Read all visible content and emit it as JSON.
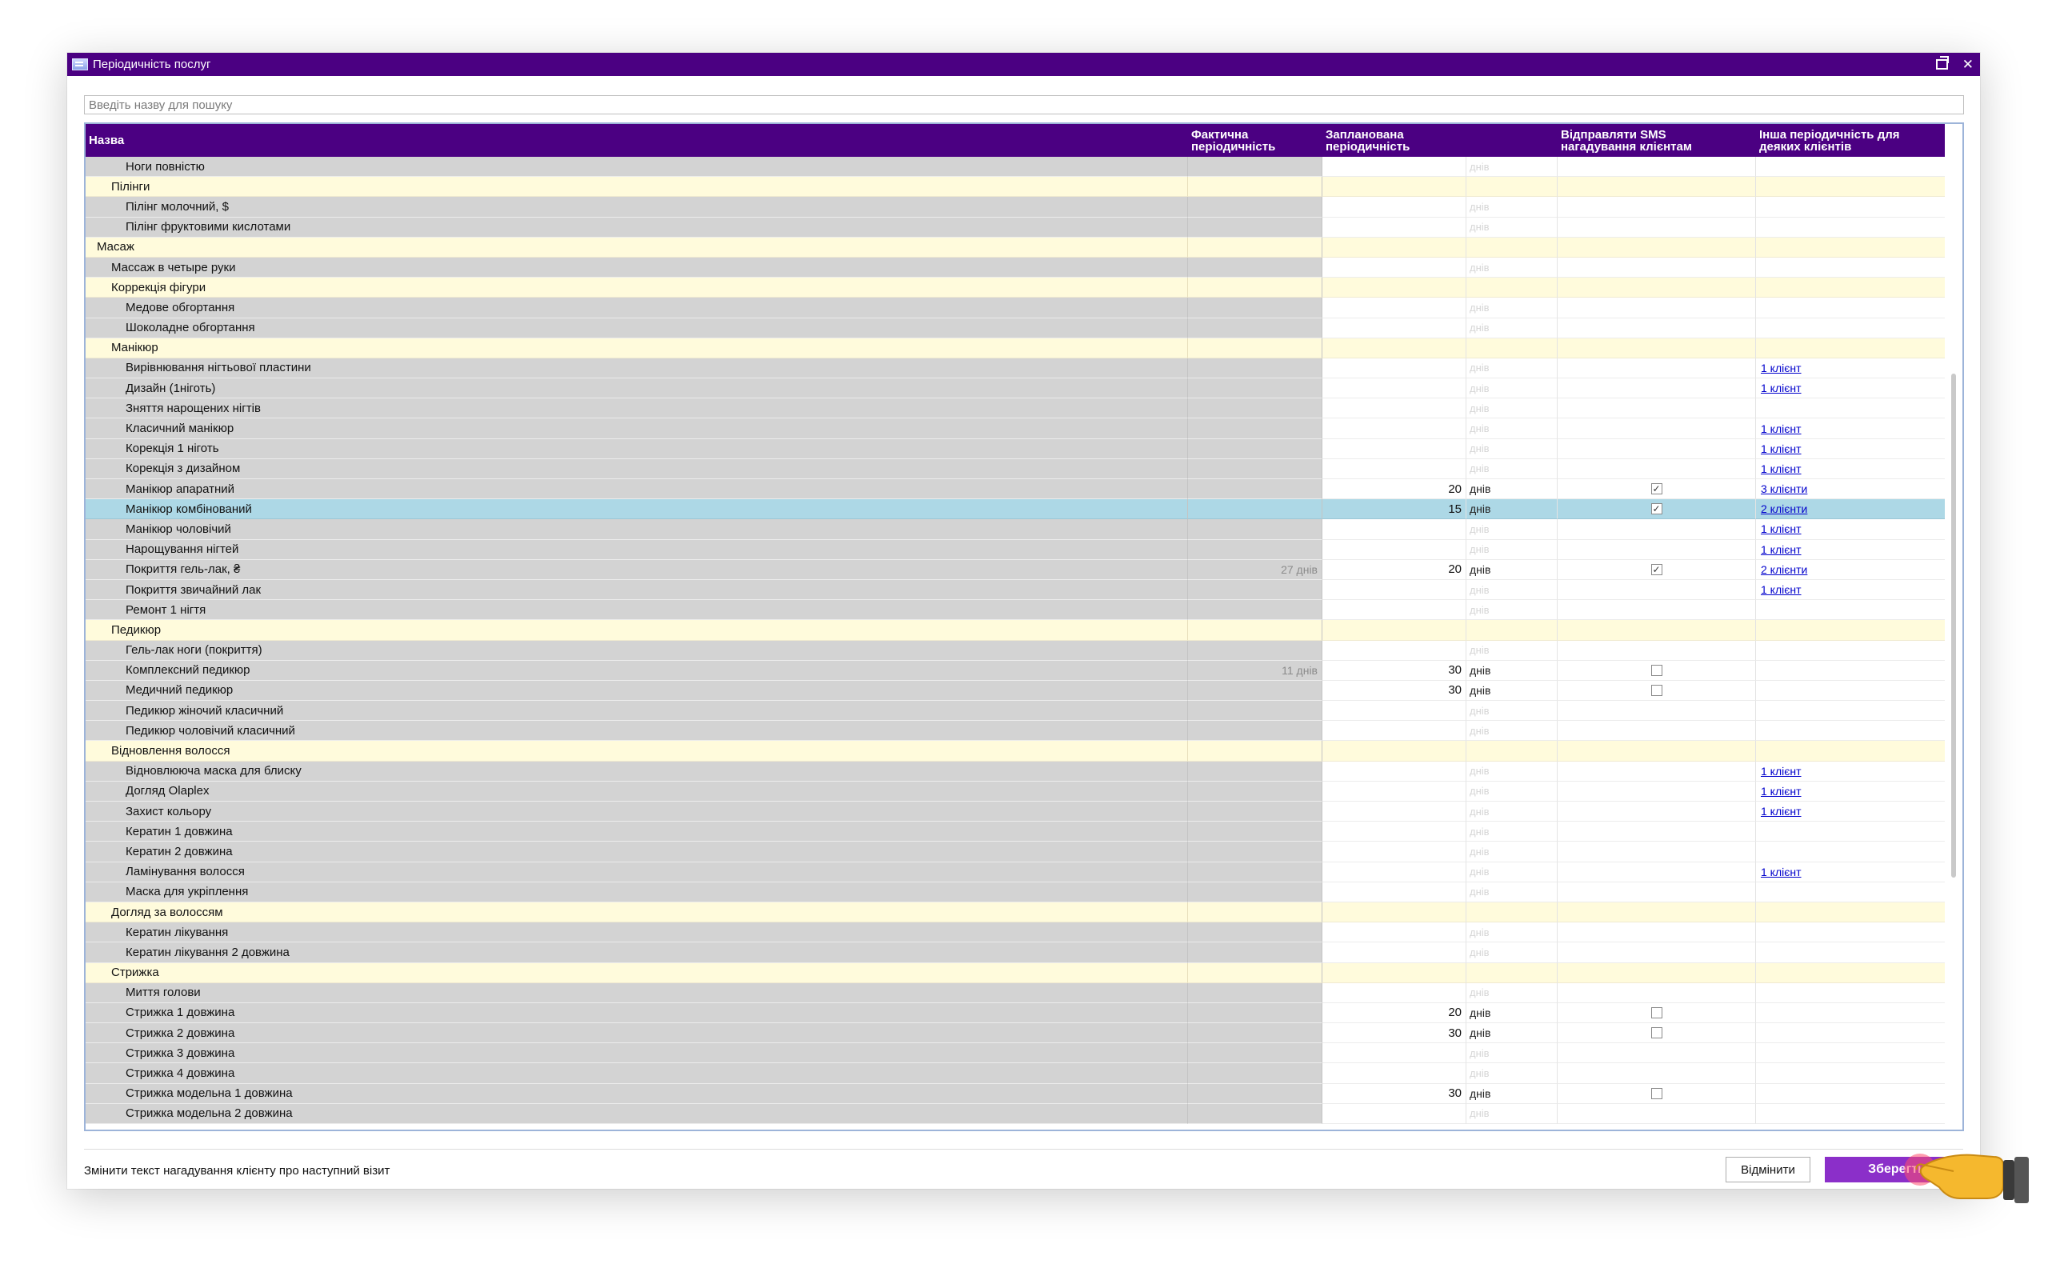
{
  "window": {
    "title": "Періодичність послуг"
  },
  "search": {
    "placeholder": "Введіть назву для пошуку"
  },
  "columns": {
    "name": "Назва",
    "fact": "Фактична періодичність",
    "plan": "Запланована періодичність",
    "sms": "Відправляти SMS нагадування клієнтам",
    "other": "Інша періодичність для деяких клієнтів"
  },
  "unit_label": "днів",
  "rows": [
    {
      "level": 3,
      "name": "Ноги повністю",
      "group": false
    },
    {
      "level": 2,
      "name": "Пілінги",
      "group": true
    },
    {
      "level": 3,
      "name": "Пілінг молочний, $",
      "group": false
    },
    {
      "level": 3,
      "name": "Пілінг фруктовими кислотами",
      "group": false
    },
    {
      "level": 1,
      "name": "Масаж",
      "group": true
    },
    {
      "level": 2,
      "name": "Массаж в четыре руки",
      "group": false
    },
    {
      "level": 2,
      "name": "Коррекція фігури",
      "group": true
    },
    {
      "level": 3,
      "name": "Медове обгортання",
      "group": false
    },
    {
      "level": 3,
      "name": "Шоколадне обгортання",
      "group": false
    },
    {
      "level": 2,
      "name": "Манікюр",
      "group": true
    },
    {
      "level": 3,
      "name": "Вирівнювання нігтьової пластини",
      "group": false,
      "other": "1 клієнт"
    },
    {
      "level": 3,
      "name": "Дизайн (1ніготь)",
      "group": false,
      "other": "1 клієнт"
    },
    {
      "level": 3,
      "name": "Зняття нарощених нігтів",
      "group": false
    },
    {
      "level": 3,
      "name": "Класичний манікюр",
      "group": false,
      "other": "1 клієнт"
    },
    {
      "level": 3,
      "name": "Корекція 1 ніготь",
      "group": false,
      "other": "1 клієнт"
    },
    {
      "level": 3,
      "name": "Корекція з дизайном",
      "group": false,
      "other": "1 клієнт"
    },
    {
      "level": 3,
      "name": "Манікюр апаратний",
      "group": false,
      "plan": "20",
      "sms": "checked",
      "other": "3 клієнти"
    },
    {
      "level": 3,
      "name": "Манікюр комбінований",
      "group": false,
      "plan": "15",
      "sms": "checked",
      "other": "2 клієнти",
      "selected": true
    },
    {
      "level": 3,
      "name": "Манікюр чоловічий",
      "group": false,
      "other": "1 клієнт"
    },
    {
      "level": 3,
      "name": "Нарощування нігтей",
      "group": false,
      "other": "1 клієнт"
    },
    {
      "level": 3,
      "name": "Покриття гель-лак, ₴",
      "group": false,
      "fact": "27 днів",
      "plan": "20",
      "sms": "checked",
      "other": "2 клієнти"
    },
    {
      "level": 3,
      "name": "Покриття звичайний лак",
      "group": false,
      "other": "1 клієнт"
    },
    {
      "level": 3,
      "name": "Ремонт 1 нігтя",
      "group": false
    },
    {
      "level": 2,
      "name": "Педикюр",
      "group": true
    },
    {
      "level": 3,
      "name": "Гель-лак ноги (покриття)",
      "group": false
    },
    {
      "level": 3,
      "name": "Комплексний педикюр",
      "group": false,
      "fact": "11 днів",
      "plan": "30",
      "sms": "unchecked"
    },
    {
      "level": 3,
      "name": "Медичний педикюр",
      "group": false,
      "plan": "30",
      "sms": "unchecked"
    },
    {
      "level": 3,
      "name": "Педикюр жіночий класичний",
      "group": false
    },
    {
      "level": 3,
      "name": "Педикюр чоловічий класичний",
      "group": false
    },
    {
      "level": 2,
      "name": "Відновлення волосся",
      "group": true
    },
    {
      "level": 3,
      "name": "Відновлююча маска для блиску",
      "group": false,
      "other": "1 клієнт"
    },
    {
      "level": 3,
      "name": "Догляд Olaplex",
      "group": false,
      "other": "1 клієнт"
    },
    {
      "level": 3,
      "name": "Захист кольору",
      "group": false,
      "other": "1 клієнт"
    },
    {
      "level": 3,
      "name": "Кератин 1 довжина",
      "group": false
    },
    {
      "level": 3,
      "name": "Кератин 2 довжина",
      "group": false
    },
    {
      "level": 3,
      "name": "Ламінування волосся",
      "group": false,
      "other": "1 клієнт"
    },
    {
      "level": 3,
      "name": "Маска для укріплення",
      "group": false
    },
    {
      "level": 2,
      "name": "Догляд за волоссям",
      "group": true
    },
    {
      "level": 3,
      "name": "Кератин лікування",
      "group": false
    },
    {
      "level": 3,
      "name": "Кератин лікування 2 довжина",
      "group": false
    },
    {
      "level": 2,
      "name": "Стрижка",
      "group": true
    },
    {
      "level": 3,
      "name": "Миття голови",
      "group": false
    },
    {
      "level": 3,
      "name": "Стрижка 1 довжина",
      "group": false,
      "plan": "20",
      "sms": "unchecked"
    },
    {
      "level": 3,
      "name": "Стрижка 2 довжина",
      "group": false,
      "plan": "30",
      "sms": "unchecked"
    },
    {
      "level": 3,
      "name": "Стрижка 3 довжина",
      "group": false
    },
    {
      "level": 3,
      "name": "Стрижка 4 довжина",
      "group": false
    },
    {
      "level": 3,
      "name": "Стрижка модельна 1 довжина",
      "group": false,
      "plan": "30",
      "sms": "unchecked"
    },
    {
      "level": 3,
      "name": "Стрижка модельна 2 довжина",
      "group": false
    }
  ],
  "footer": {
    "change_text_link": "Змінити текст нагадування клієнту про наступний візит",
    "cancel_label": "Відмінити",
    "save_label": "Зберегти"
  },
  "colors": {
    "titlebar": "#4b0082",
    "group_row": "#fffbdc",
    "selected_row": "#add8e6",
    "save_button": "#8b2fc9"
  },
  "icons": {
    "window_app": "window-app-icon",
    "restore": "restore-icon",
    "close": "close-icon",
    "pointer_hand": "pointing-hand-icon"
  }
}
